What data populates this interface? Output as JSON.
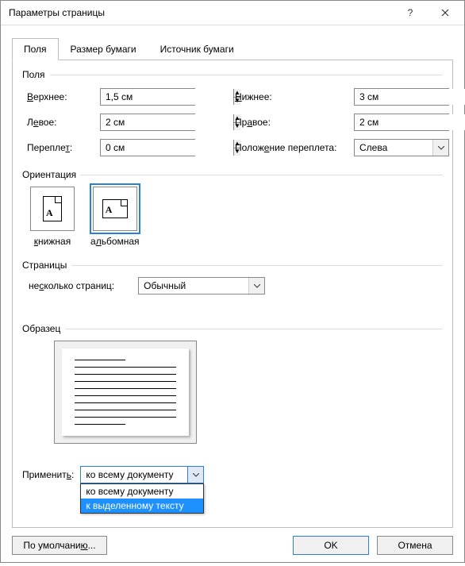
{
  "window": {
    "title": "Параметры страницы"
  },
  "tabs": {
    "t0": "Поля",
    "t1": "Размер бумаги",
    "t2": "Источник бумаги"
  },
  "groups": {
    "margins": "Поля",
    "orientation": "Ориентация",
    "pages": "Страницы",
    "preview": "Образец"
  },
  "margins": {
    "top_label": "Верхнее:",
    "top_value": "1,5 см",
    "bottom_label": "Нижнее:",
    "bottom_value": "3 см",
    "left_label": "Левое:",
    "left_value": "2 см",
    "right_label": "Правое:",
    "right_value": "2 см",
    "gutter_label": "Переплет:",
    "gutter_value": "0 см",
    "gutter_pos_label": "Положение переплета:",
    "gutter_pos_value": "Слева"
  },
  "orientation": {
    "portrait": "книжная",
    "landscape": "альбомная",
    "selected": "landscape"
  },
  "pages": {
    "multi_label": "несколько страниц:",
    "multi_value": "Обычный"
  },
  "apply": {
    "label": "Применить:",
    "value": "ко всему документу",
    "options": [
      "ко всему документу",
      "к выделенному тексту"
    ],
    "highlighted": "к выделенному тексту"
  },
  "buttons": {
    "default": "По умолчанию...",
    "ok": "OK",
    "cancel": "Отмена"
  }
}
